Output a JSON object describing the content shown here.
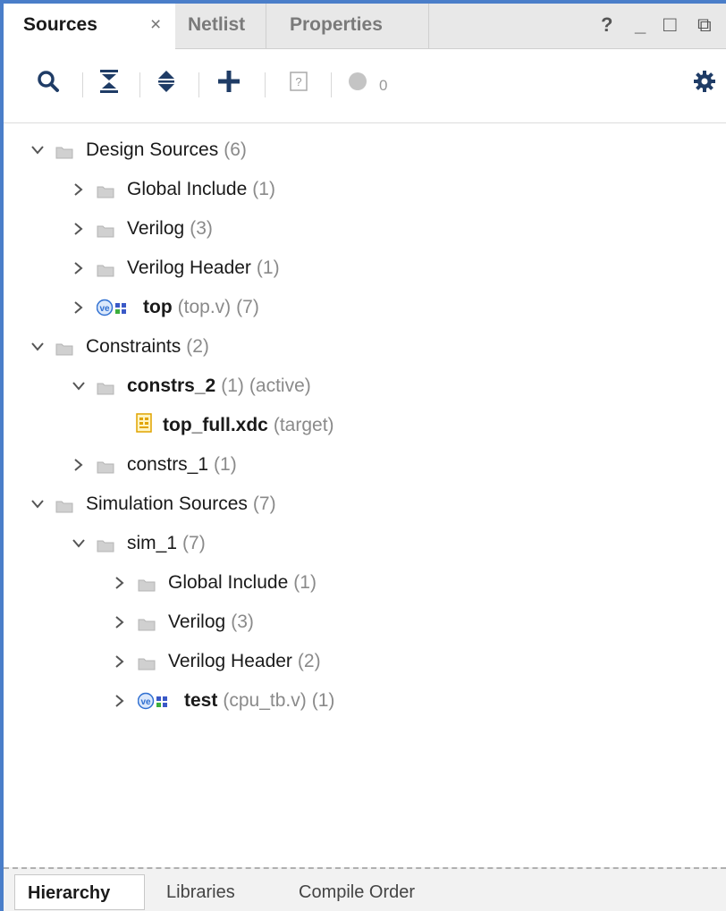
{
  "tabs": {
    "sources": "Sources",
    "close": "×",
    "netlist": "Netlist",
    "properties": "Properties"
  },
  "window_controls": {
    "help": "?",
    "minimize": "_",
    "maximize": "□",
    "float": "⧉"
  },
  "toolbar": {
    "icons": [
      "search-icon",
      "collapse-all-icon",
      "expand-all-icon",
      "add-icon",
      "unknown-icon",
      "status-dot-icon",
      "gear-icon"
    ],
    "status_count": "0"
  },
  "tree": {
    "design_sources": {
      "label": "Design Sources",
      "count": "(6)"
    },
    "ds_global_include": {
      "label": "Global Include",
      "count": "(1)"
    },
    "ds_verilog": {
      "label": "Verilog",
      "count": "(3)"
    },
    "ds_verilog_header": {
      "label": "Verilog Header",
      "count": "(1)"
    },
    "ds_top": {
      "label": "top",
      "extra": "(top.v)",
      "count": "(7)"
    },
    "constraints": {
      "label": "Constraints",
      "count": "(2)"
    },
    "constrs_2": {
      "label": "constrs_2",
      "count": "(1)",
      "extra": "(active)"
    },
    "top_full_xdc": {
      "label": "top_full.xdc",
      "extra": "(target)"
    },
    "constrs_1": {
      "label": "constrs_1",
      "count": "(1)"
    },
    "simulation_sources": {
      "label": "Simulation Sources",
      "count": "(7)"
    },
    "sim_1": {
      "label": "sim_1",
      "count": "(7)"
    },
    "sim_global_include": {
      "label": "Global Include",
      "count": "(1)"
    },
    "sim_verilog": {
      "label": "Verilog",
      "count": "(3)"
    },
    "sim_verilog_header": {
      "label": "Verilog Header",
      "count": "(2)"
    },
    "sim_test": {
      "label": "test",
      "extra": "(cpu_tb.v)",
      "count": "(1)"
    }
  },
  "bottom_tabs": {
    "hierarchy": "Hierarchy",
    "libraries": "Libraries",
    "compile_order": "Compile Order"
  },
  "colors": {
    "accent_border": "#4a7ec9",
    "folder": "#c9c9c9",
    "ve_icon": "#2f6fd1",
    "xdc_icon": "#e0a400"
  }
}
